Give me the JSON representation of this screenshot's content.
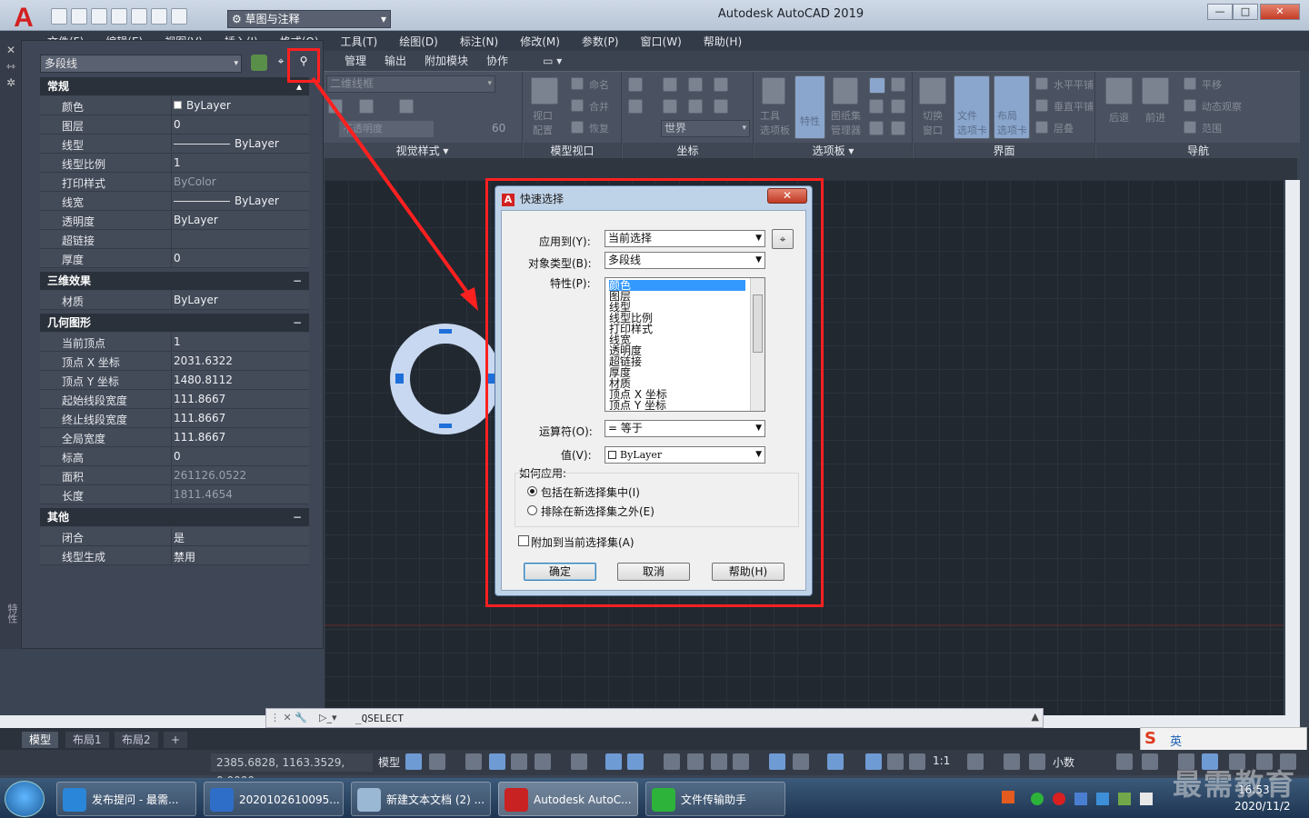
{
  "app": {
    "title": "Autodesk AutoCAD 2019",
    "logo": "A",
    "workspace": "草图与注释",
    "win_buttons": [
      "—",
      "□",
      "✕"
    ]
  },
  "menus": [
    "文件(F)",
    "编辑(E)",
    "视图(V)",
    "插入(I)",
    "格式(O)",
    "工具(T)",
    "绘图(D)",
    "标注(N)",
    "修改(M)",
    "参数(P)",
    "窗口(W)",
    "帮助(H)"
  ],
  "ribbon": {
    "tabs": [
      "管理",
      "输出",
      "附加模块",
      "协作"
    ],
    "visual_style_value": "二维线框",
    "transparency_label": "不透明度",
    "transparency_value": "60",
    "panel_titles": [
      "视觉样式 ▾",
      "模型视口",
      "坐标",
      "选项板 ▾",
      "界面",
      "导航"
    ],
    "tools": {
      "viewport_config": "视口\n配置",
      "name": "命名",
      "join": "合并",
      "restore": "恢复",
      "world": "世界",
      "tool_palettes": "工具\n选项板",
      "props": "特性",
      "sheetset": "图纸集\n管理器",
      "switch_window": "切换\n窗口",
      "file_tabs": "文件\n选项卡",
      "layout_tabs": "布局\n选项卡",
      "tile_h": "水平平铺",
      "tile_v": "垂直平铺",
      "cascade": "层叠",
      "back": "后退",
      "forward": "前进",
      "pan": "平移",
      "dynamic_view": "动态观察",
      "extent": "范围"
    }
  },
  "palette": {
    "object_type": "多段线",
    "sections": {
      "general": "常规",
      "three_d": "三维效果",
      "geometry": "几何图形",
      "misc": "其他"
    },
    "general": [
      {
        "k": "颜色",
        "v": "ByLayer"
      },
      {
        "k": "图层",
        "v": "0"
      },
      {
        "k": "线型",
        "v": "ByLayer"
      },
      {
        "k": "线型比例",
        "v": "1"
      },
      {
        "k": "打印样式",
        "v": "ByColor"
      },
      {
        "k": "线宽",
        "v": "ByLayer"
      },
      {
        "k": "透明度",
        "v": "ByLayer"
      },
      {
        "k": "超链接",
        "v": ""
      },
      {
        "k": "厚度",
        "v": "0"
      }
    ],
    "three_d": [
      {
        "k": "材质",
        "v": "ByLayer"
      }
    ],
    "geometry": [
      {
        "k": "当前顶点",
        "v": "1"
      },
      {
        "k": "顶点 X 坐标",
        "v": "2031.6322"
      },
      {
        "k": "顶点 Y 坐标",
        "v": "1480.8112"
      },
      {
        "k": "起始线段宽度",
        "v": "111.8667"
      },
      {
        "k": "终止线段宽度",
        "v": "111.8667"
      },
      {
        "k": "全局宽度",
        "v": "111.8667"
      },
      {
        "k": "标高",
        "v": "0"
      },
      {
        "k": "面积",
        "v": "261126.0522"
      },
      {
        "k": "长度",
        "v": "1811.4654"
      }
    ],
    "misc": [
      {
        "k": "闭合",
        "v": "是"
      },
      {
        "k": "线型生成",
        "v": "禁用"
      }
    ],
    "side_label": "特性"
  },
  "dialog": {
    "title": "快速选择",
    "apply_to_label": "应用到(Y):",
    "apply_to_value": "当前选择",
    "object_type_label": "对象类型(B):",
    "object_type_value": "多段线",
    "properties_label": "特性(P):",
    "properties": [
      "颜色",
      "图层",
      "线型",
      "线型比例",
      "打印样式",
      "线宽",
      "透明度",
      "超链接",
      "厚度",
      "材质",
      "顶点 X 坐标",
      "顶点 Y 坐标"
    ],
    "operator_label": "运算符(O):",
    "operator_value": "= 等于",
    "value_label": "值(V):",
    "value_value": "ByLayer",
    "how_to_apply": "如何应用:",
    "include_label": "包括在新选择集中(I)",
    "exclude_label": "排除在新选择集之外(E)",
    "append_label": "附加到当前选择集(A)",
    "ok": "确定",
    "cancel": "取消",
    "help": "帮助(H)",
    "close": "✕"
  },
  "command_line": "_QSELECT",
  "layout_tabs": [
    "模型",
    "布局1",
    "布局2",
    "+"
  ],
  "status": {
    "coords": "2385.6828, 1163.3529, 0.0000",
    "model": "模型",
    "scale": "1:1",
    "units": "小数"
  },
  "taskbar": {
    "items": [
      "发布提问 - 最需...",
      "2020102610095...",
      "新建文本文档 (2) ...",
      "Autodesk AutoC...",
      "文件传输助手"
    ],
    "time": "16:53",
    "date": "2020/11/2",
    "ime": "英"
  },
  "watermark": "最需教育",
  "colors": {
    "accent_red": "#ff2020",
    "drawing_bg": "#212830",
    "ring": "#c8d8f0",
    "grip": "#1e6fd9",
    "selected": "#3399ff"
  }
}
